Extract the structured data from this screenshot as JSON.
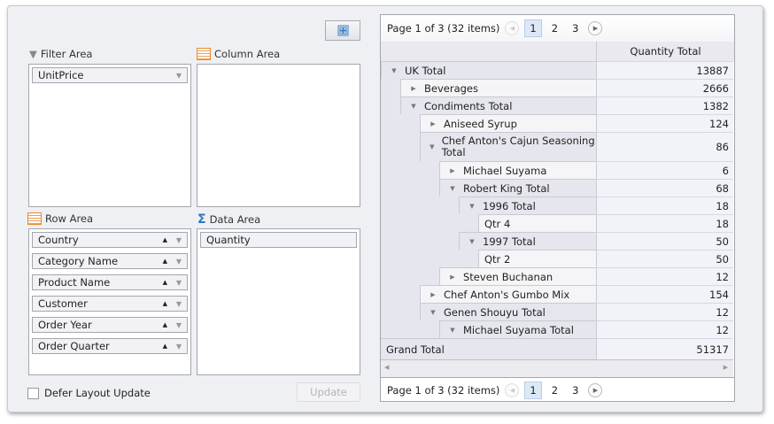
{
  "layout_button": {
    "icon": "grid-layout-icon"
  },
  "filter_area": {
    "label": "Filter Area",
    "fields": [
      "UnitPrice"
    ]
  },
  "column_area": {
    "label": "Column Area",
    "fields": []
  },
  "row_area": {
    "label": "Row Area",
    "fields": [
      "Country",
      "Category Name",
      "Product Name",
      "Customer",
      "Order Year",
      "Order Quarter"
    ]
  },
  "data_area": {
    "label": "Data Area",
    "fields": [
      "Quantity"
    ]
  },
  "defer": {
    "label": "Defer Layout Update",
    "checked": false
  },
  "update_label": "Update",
  "pager": {
    "text": "Page 1 of 3 (32 items)",
    "pages": [
      "1",
      "2",
      "3"
    ],
    "current": "1"
  },
  "grid": {
    "column_header": "Quantity Total",
    "rows": [
      {
        "label": "UK Total",
        "value": "13887",
        "level": 0,
        "state": "expanded"
      },
      {
        "label": "Beverages",
        "value": "2666",
        "level": 1,
        "state": "collapsed"
      },
      {
        "label": "Condiments Total",
        "value": "1382",
        "level": 1,
        "state": "expanded"
      },
      {
        "label": "Aniseed Syrup",
        "value": "124",
        "level": 2,
        "state": "collapsed"
      },
      {
        "label": "Chef Anton's Cajun Seasoning Total",
        "value": "86",
        "level": 2,
        "state": "expanded",
        "tall": true
      },
      {
        "label": "Michael Suyama",
        "value": "6",
        "level": 3,
        "state": "collapsed"
      },
      {
        "label": "Robert King Total",
        "value": "68",
        "level": 3,
        "state": "expanded"
      },
      {
        "label": "1996 Total",
        "value": "18",
        "level": 4,
        "state": "expanded"
      },
      {
        "label": "Qtr 4",
        "value": "18",
        "level": 5,
        "state": "none"
      },
      {
        "label": "1997 Total",
        "value": "50",
        "level": 4,
        "state": "expanded"
      },
      {
        "label": "Qtr 2",
        "value": "50",
        "level": 5,
        "state": "none"
      },
      {
        "label": "Steven Buchanan",
        "value": "12",
        "level": 3,
        "state": "collapsed"
      },
      {
        "label": "Chef Anton's Gumbo Mix",
        "value": "154",
        "level": 2,
        "state": "collapsed"
      },
      {
        "label": "Genen Shouyu Total",
        "value": "12",
        "level": 2,
        "state": "expanded"
      },
      {
        "label": "Michael Suyama Total",
        "value": "12",
        "level": 3,
        "state": "expanded"
      }
    ],
    "grand_total": {
      "label": "Grand Total",
      "value": "51317"
    }
  }
}
